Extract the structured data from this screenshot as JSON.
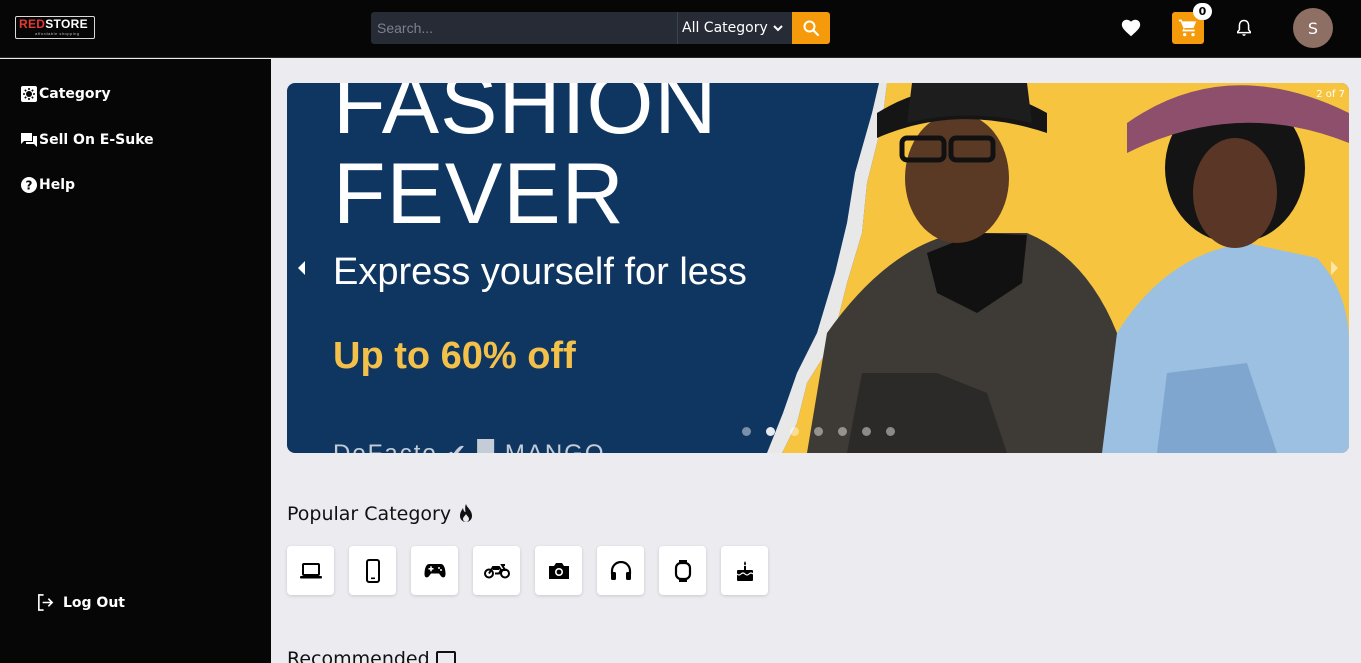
{
  "header": {
    "logo": {
      "brand_red": "RED",
      "brand_white": "STORE",
      "tagline": "affordable shopping"
    },
    "search": {
      "placeholder": "Search..."
    },
    "category_select": {
      "selected": "All Category"
    },
    "cart_count": "0",
    "avatar_initial": "S",
    "accent_color": "#F59B0B"
  },
  "sidebar": {
    "items": [
      {
        "label": "Category",
        "icon": "category-icon"
      },
      {
        "label": "Sell On E-Suke",
        "icon": "chat-icon"
      },
      {
        "label": "Help",
        "icon": "help-icon"
      }
    ],
    "logout_label": "Log Out"
  },
  "banner": {
    "headline_1": "FASHION",
    "headline_2": "FEVER",
    "subline": "Express yourself for less",
    "offer": "Up to 60% off",
    "brands": "DeFacto  ✔  █  MANGO",
    "slide_counter": "2 of 7",
    "slide_total": 7,
    "active_slide": 2
  },
  "popular": {
    "title": "Popular Category",
    "categories": [
      {
        "icon": "laptop-icon"
      },
      {
        "icon": "phone-icon"
      },
      {
        "icon": "gamepad-icon"
      },
      {
        "icon": "motorcycle-icon"
      },
      {
        "icon": "camera-icon"
      },
      {
        "icon": "headphones-icon"
      },
      {
        "icon": "watch-icon"
      },
      {
        "icon": "cake-icon"
      }
    ]
  },
  "recommended": {
    "title": "Recommended"
  }
}
